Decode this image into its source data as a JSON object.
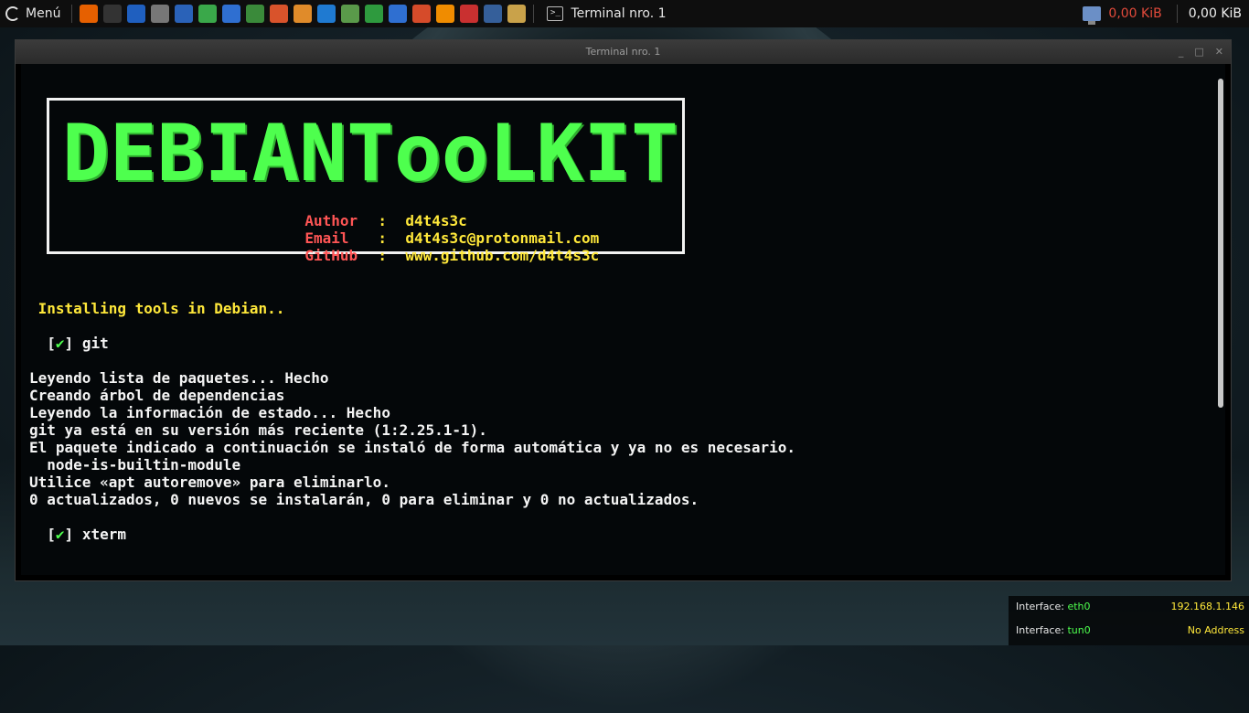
{
  "panel": {
    "menu_label": "Menú",
    "launchers": [
      {
        "icon": "firefox-icon",
        "color": "#e66000"
      },
      {
        "icon": "terminal-icon",
        "color": "#333333"
      },
      {
        "icon": "malwarebytes-icon",
        "color": "#1f5fbf"
      },
      {
        "icon": "calculator-icon",
        "color": "#777777"
      },
      {
        "icon": "eye-icon",
        "color": "#2a62b8"
      },
      {
        "icon": "lightning-icon",
        "color": "#3aa84a"
      },
      {
        "icon": "shark-icon",
        "color": "#2f6fd1"
      },
      {
        "icon": "python-icon",
        "color": "#3a8a3a"
      },
      {
        "icon": "burp-icon",
        "color": "#d9532b"
      },
      {
        "icon": "sublime-icon",
        "color": "#e08b2a"
      },
      {
        "icon": "vscode-icon",
        "color": "#1f7ad1"
      },
      {
        "icon": "editor-icon",
        "color": "#5a9a4a"
      },
      {
        "icon": "spreadsheet-icon",
        "color": "#2e9a3e"
      },
      {
        "icon": "document-icon",
        "color": "#2f6fd1"
      },
      {
        "icon": "presentation-icon",
        "color": "#d64b2a"
      },
      {
        "icon": "vlc-icon",
        "color": "#f08c00"
      },
      {
        "icon": "recorder-icon",
        "color": "#c93030"
      },
      {
        "icon": "search-icon",
        "color": "#355f9a"
      },
      {
        "icon": "palette-icon",
        "color": "#c9a24a"
      }
    ],
    "task_title": "Terminal nro. 1",
    "net_speed_down": "0,00 KiB",
    "net_speed_up": "0,00 KiB"
  },
  "window": {
    "title": "Terminal nro. 1"
  },
  "banner": {
    "ascii": [
      "D",
      "E",
      "B",
      "I",
      "A",
      "N",
      "T",
      "o",
      "o",
      "L",
      "K",
      "I",
      "T"
    ],
    "author_label": "Author",
    "author_value": "d4t4s3c",
    "email_label": "Email",
    "email_value": "d4t4s3c@protonmail.com",
    "github_label": "GitHub",
    "github_value": "www.github.com/d4t4s3c",
    "colon": ":"
  },
  "terminal": {
    "installing": " Installing tools in Debian..",
    "bracket_open": "  [",
    "check": "✔",
    "bracket_close": "]",
    "tool1": " git",
    "output": [
      "Leyendo lista de paquetes... Hecho",
      "Creando árbol de dependencias",
      "Leyendo la información de estado... Hecho",
      "git ya está en su versión más reciente (1:2.25.1-1).",
      "El paquete indicado a continuación se instaló de forma automática y ya no es necesario.",
      "  node-is-builtin-module",
      "Utilice «apt autoremove» para eliminarlo.",
      "0 actualizados, 0 nuevos se instalarán, 0 para eliminar y 0 no actualizados."
    ],
    "tool2": " xterm"
  },
  "conky": {
    "label": "Interface:",
    "iface1": "eth0",
    "addr1": "192.168.1.146",
    "iface2": "tun0",
    "addr2": "No Address"
  }
}
